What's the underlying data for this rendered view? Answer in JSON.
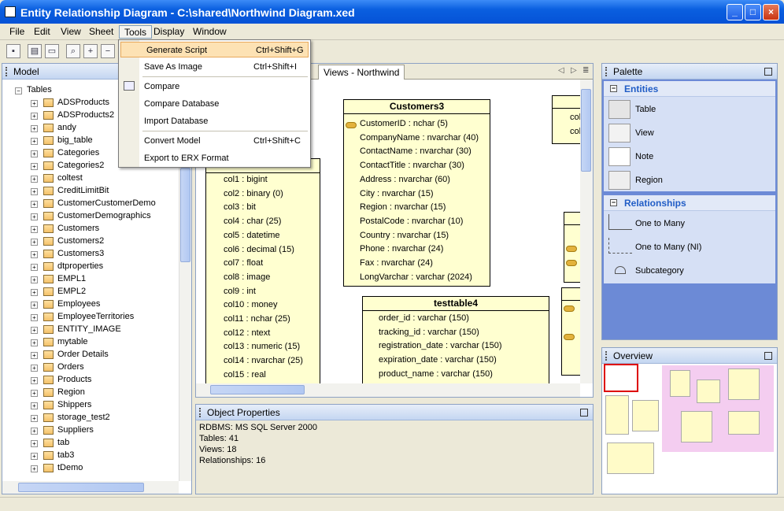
{
  "window": {
    "title": "Entity Relationship Diagram - C:\\shared\\Northwind Diagram.xed"
  },
  "menubar": [
    "File",
    "Edit",
    "View",
    "Sheet",
    "Tools",
    "Display",
    "Window"
  ],
  "tools_menu": {
    "items": [
      {
        "label": "Generate Script",
        "shortcut": "Ctrl+Shift+G"
      },
      {
        "label": "Save As Image",
        "shortcut": "Ctrl+Shift+I"
      },
      {
        "label": "Compare",
        "shortcut": ""
      },
      {
        "label": "Compare Database",
        "shortcut": ""
      },
      {
        "label": "Import Database",
        "shortcut": ""
      },
      {
        "label": "Convert Model",
        "shortcut": "Ctrl+Shift+C"
      },
      {
        "label": "Export to ERX Format",
        "shortcut": ""
      }
    ]
  },
  "model_panel": {
    "title": "Model",
    "root": "Tables",
    "tables": [
      "ADSProducts",
      "ADSProducts2",
      "andy",
      "big_table",
      "Categories",
      "Categories2",
      "coltest",
      "CreditLimitBit",
      "CustomerCustomerDemo",
      "CustomerDemographics",
      "Customers",
      "Customers2",
      "Customers3",
      "dtproperties",
      "EMPL1",
      "EMPL2",
      "Employees",
      "EmployeeTerritories",
      "ENTITY_IMAGE",
      "mytable",
      "Order Details",
      "Orders",
      "Products",
      "Region",
      "Shippers",
      "storage_test2",
      "Suppliers",
      "tab",
      "tab3",
      "tDemo"
    ]
  },
  "diagram": {
    "tab": "Views - Northwind",
    "entities": {
      "customers3": {
        "name": "Customers3",
        "attrs": [
          "CustomerID : nchar (5)",
          "CompanyName : nvarchar (40)",
          "ContactName : nvarchar (30)",
          "ContactTitle : nvarchar (30)",
          "Address : nvarchar (60)",
          "City : nvarchar (15)",
          "Region : nvarchar (15)",
          "PostalCode : nvarchar (10)",
          "Country : nvarchar (15)",
          "Phone : nvarchar (24)",
          "Fax : nvarchar (24)",
          "LongVarchar : varchar (2024)"
        ]
      },
      "testtable4": {
        "name": "testtable4",
        "attrs": [
          "order_id : varchar (150)",
          "tracking_id : varchar (150)",
          "registration_date : varchar (150)",
          "expiration_date : varchar (150)",
          "product_name : varchar (150)"
        ]
      },
      "left": {
        "attrs": [
          "col1 : bigint",
          "col2 : binary (0)",
          "col3 : bit",
          "col4 : char (25)",
          "col5 : datetime",
          "col6 : decimal (15)",
          "col7 : float",
          "col8 : image",
          "col9 : int",
          "col10 : money",
          "col11 : nchar (25)",
          "col12 : ntext",
          "col13 : numeric (15)",
          "col14 : nvarchar (25)",
          "col15 : real"
        ]
      },
      "right_top": {
        "attrs": [
          "col",
          "col"
        ]
      }
    }
  },
  "object_properties": {
    "title": "Object Properties",
    "lines": [
      "RDBMS: MS SQL Server 2000",
      "Tables: 41",
      "Views: 18",
      "Relationships: 16"
    ]
  },
  "palette": {
    "title": "Palette",
    "entities_group": {
      "title": "Entities",
      "items": [
        "Table",
        "View",
        "Note",
        "Region"
      ]
    },
    "relationships_group": {
      "title": "Relationships",
      "items": [
        "One to Many",
        "One to Many (NI)",
        "Subcategory"
      ]
    }
  },
  "overview": {
    "title": "Overview"
  },
  "colors": {
    "entity_fill": "#ffffd0",
    "menu_highlight": "#fde2b4",
    "title_blue": "#0a5fe0",
    "palette_bg": "#6c8ad6"
  }
}
